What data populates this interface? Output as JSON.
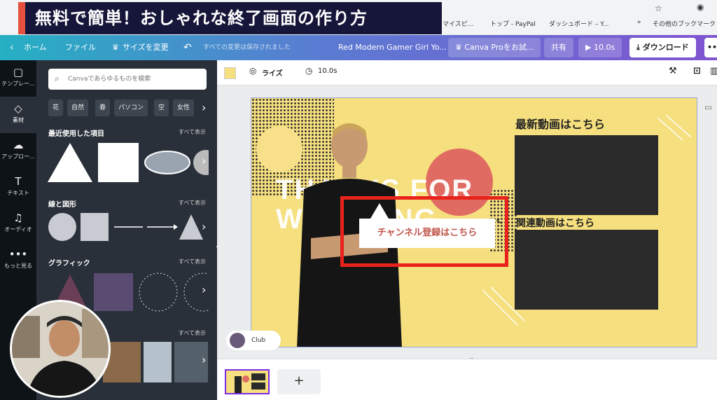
{
  "overlay": {
    "title": "無料で簡単！おしゃれな終了画面の作り方"
  },
  "bookmarks": {
    "b1": "マイスピ...",
    "b2": "トップ - PayPal",
    "b3": "ダッシュボード – Y...",
    "more": "»",
    "other": "その他のブックマーク"
  },
  "topbar": {
    "home": "ホーム",
    "file": "ファイル",
    "resize": "サイズを変更",
    "saved": "すべての変更は保存されました",
    "design_title": "Red Modern Gamer Girl Yo...",
    "pro": "Canva Proをお試...",
    "share": "共有",
    "play": "10.0s",
    "download": "ダウンロード",
    "more": "•••"
  },
  "leftnav": [
    {
      "label": "テンプレー...",
      "icon": "▢"
    },
    {
      "label": "素材",
      "icon": "◇"
    },
    {
      "label": "アップロー...",
      "icon": "☁"
    },
    {
      "label": "テキスト",
      "icon": "T"
    },
    {
      "label": "オーディオ",
      "icon": "♫"
    },
    {
      "label": "もっと見る",
      "icon": "•••"
    }
  ],
  "panel": {
    "search_placeholder": "Canvaであらゆるものを検索",
    "chips": [
      "花",
      "自然",
      "春",
      "パソコン",
      "空",
      "女性"
    ],
    "recent_title": "最近使用した項目",
    "lines_title": "線と図形",
    "graphics_title": "グラフィック",
    "see_all": "すべて表示"
  },
  "subbar": {
    "swatch_color": "#f6df7e",
    "lights": "ライズ",
    "duration": "10.0s"
  },
  "design": {
    "thanks": "THANKS FOR WATCHING",
    "latest": "最新動画はこちら",
    "related": "関連動画はこちら",
    "channel": "チャンネル登録はこちら"
  },
  "club": "Club",
  "add": "+",
  "colors": {
    "bg_yellow": "#f6df7e",
    "red": "#e06b63",
    "highlight": "#e8231b",
    "accent": "#7d2ae8"
  }
}
